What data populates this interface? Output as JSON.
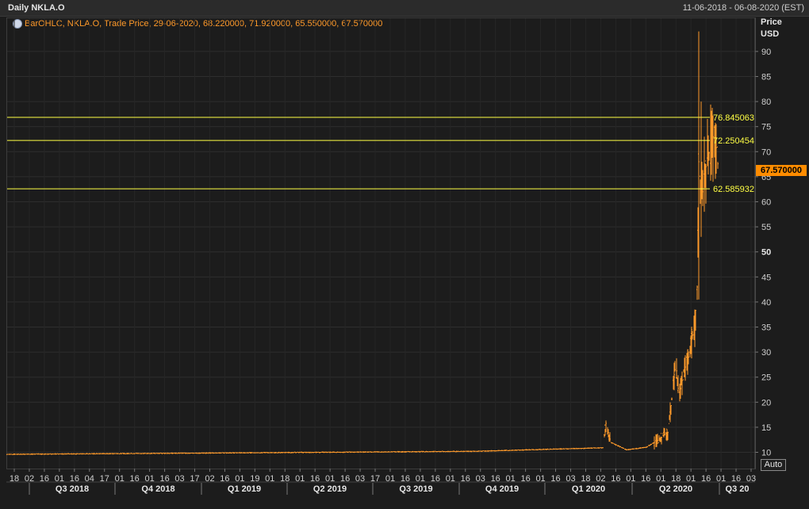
{
  "header": {
    "title": "Daily NKLA.O",
    "date_range": "11-06-2018 - 06-08-2020 (EST)"
  },
  "legend": {
    "icon": "series-icon",
    "text": "BarOHLC, NKLA.O, Trade Price, 29-06-2020, 68.220000, 71.920000, 65.550000, 67.570000"
  },
  "axis": {
    "unit_line1": "Price",
    "unit_line2": "USD",
    "auto_label": "Auto"
  },
  "last_price_label": "67.570000",
  "colors": {
    "bars": "#ff9a2a",
    "hlines": "#ffff44",
    "last_price_bg": "#ff8c00",
    "background": "#1c1c1c"
  },
  "chart_data": {
    "type": "bar",
    "subtype": "ohlc",
    "title": "Daily NKLA.O",
    "ylabel": "Price USD",
    "ylim": [
      8,
      98
    ],
    "yticks": [
      10,
      15,
      20,
      25,
      30,
      35,
      40,
      45,
      50,
      55,
      60,
      65,
      70,
      75,
      80,
      85,
      90
    ],
    "bold_yticks": [
      50
    ],
    "grid": true,
    "hlines": [
      76.845063,
      72.250454,
      62.585932
    ],
    "hline_labels": [
      "76.845063",
      "72.250454",
      "62.585932"
    ],
    "x_day_ticks": [
      "18",
      "02",
      "16",
      "01",
      "16",
      "04",
      "17",
      "01",
      "16",
      "01",
      "16",
      "03",
      "17",
      "02",
      "16",
      "01",
      "19",
      "01",
      "18",
      "01",
      "16",
      "01",
      "16",
      "03",
      "17",
      "01",
      "16",
      "01",
      "16",
      "01",
      "16",
      "03",
      "16",
      "01",
      "16",
      "01",
      "16",
      "03",
      "18",
      "02",
      "16",
      "01",
      "16",
      "01",
      "18",
      "01",
      "16",
      "01",
      "16",
      "03"
    ],
    "quarters": [
      "Q3 2018",
      "Q4 2018",
      "Q1 2019",
      "Q2 2019",
      "Q3 2019",
      "Q4 2019",
      "Q1 2020",
      "Q2 2020",
      "Q3 20"
    ],
    "daily_ohlc_sample": [
      {
        "date": "2018-06-11",
        "close": 9.6
      },
      {
        "date": "2019-06-11",
        "close": 10.0
      },
      {
        "date": "2020-01-03",
        "close": 10.3
      },
      {
        "date": "2020-03-03",
        "close": 10.9
      },
      {
        "date": "2020-03-04",
        "high": 16.0,
        "close": 15.5
      },
      {
        "date": "2020-03-17",
        "close": 10.5
      },
      {
        "date": "2020-04-28",
        "close": 11.5
      },
      {
        "date": "2020-05-12",
        "close": 14.0
      },
      {
        "date": "2020-05-20",
        "high": 35.3,
        "close": 28.0
      },
      {
        "date": "2020-05-22",
        "close": 20.5
      },
      {
        "date": "2020-06-01",
        "high": 38.5,
        "close": 36.0
      },
      {
        "date": "2020-06-04",
        "low": 40.5,
        "close": 68.0
      },
      {
        "date": "2020-06-09",
        "high": 93.99,
        "close": 79.7
      },
      {
        "date": "2020-06-11",
        "low": 53.0,
        "close": 58.0
      },
      {
        "date": "2020-06-26",
        "high": 77.2,
        "close": 72.0
      },
      {
        "date": "2020-06-29",
        "open": 68.22,
        "high": 71.92,
        "low": 65.55,
        "close": 67.57
      }
    ],
    "last": {
      "date": "29-06-2020",
      "open": 68.22,
      "high": 71.92,
      "low": 65.55,
      "close": 67.57
    }
  }
}
